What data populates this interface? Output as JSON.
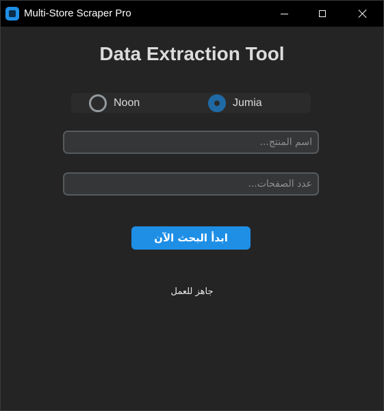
{
  "window": {
    "title": "Multi-Store Scraper Pro",
    "app_icon": "app-logo-icon",
    "controls": {
      "minimize": "minimize-icon",
      "maximize": "maximize-icon",
      "close": "close-icon"
    }
  },
  "main": {
    "heading": "Data Extraction Tool",
    "store_options": [
      {
        "label": "Noon",
        "selected": false
      },
      {
        "label": "Jumia",
        "selected": true
      }
    ],
    "product_field": {
      "value": "",
      "placeholder": "اسم المنتج..."
    },
    "pages_field": {
      "value": "",
      "placeholder": "عدد الصفحات..."
    },
    "start_button_label": "ابدأ البحث الآن",
    "status_text": "جاهز للعمل"
  },
  "colors": {
    "background": "#242424",
    "titlebar": "#000000",
    "accent": "#1f8fe6",
    "radio_selected": "#1f6aa5"
  }
}
